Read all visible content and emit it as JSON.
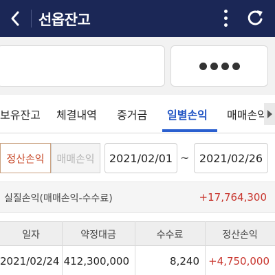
{
  "header": {
    "title": "선옵잔고",
    "background_color": "#1b2756",
    "icons": [
      "chevron-left-icon",
      "more-vertical-icon",
      "refresh-icon"
    ]
  },
  "account": {
    "account_value": "",
    "password_mask": "●●●●"
  },
  "tabs": [
    {
      "label": "보유잔고",
      "active": false
    },
    {
      "label": "체결내역",
      "active": false
    },
    {
      "label": "증거금",
      "active": false
    },
    {
      "label": "일별손익",
      "active": true
    },
    {
      "label": "매매손익",
      "active": false
    }
  ],
  "filter": {
    "segments": [
      {
        "label": "정산손익",
        "selected": true
      },
      {
        "label": "매매손익",
        "selected": false
      }
    ],
    "start_date": "2021/02/01",
    "separator": "~",
    "end_date": "2021/02/26"
  },
  "summary": {
    "label": "실질손익(매매손익-수수료)",
    "value": "+17,764,300"
  },
  "table": {
    "columns": [
      "일자",
      "약정대금",
      "수수료",
      "정산손익"
    ],
    "rows": [
      [
        "2021/02/24",
        "412,300,000",
        "8,240",
        "+4,750,000"
      ]
    ]
  },
  "colors": {
    "accent_blue": "#2a5fcf",
    "profit_red": "#c8342c",
    "segment_selected": "#c84a2a"
  }
}
